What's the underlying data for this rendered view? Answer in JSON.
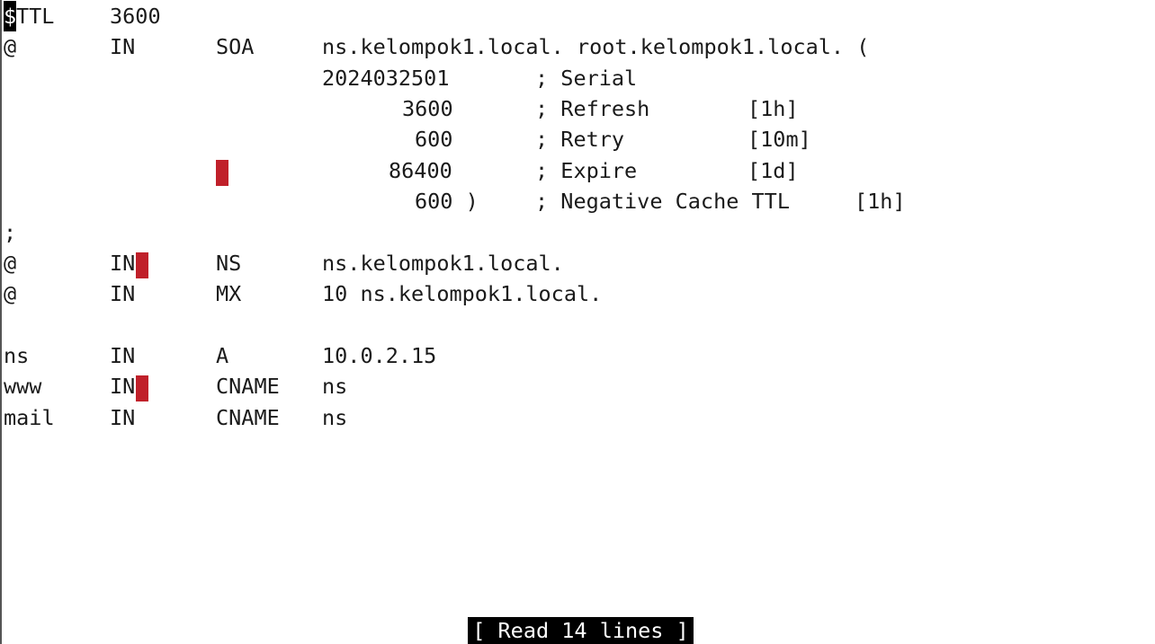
{
  "editor": {
    "ttl_line": {
      "cursor_char": "$",
      "directive": "TTL",
      "value": "3600"
    },
    "soa_line": {
      "name": "@",
      "class": "IN",
      "type": "SOA",
      "data": "ns.kelompok1.local. root.kelompok1.local. ("
    },
    "serial_line": {
      "value": "2024032501",
      "comment": "; Serial"
    },
    "refresh_line": {
      "value": "3600",
      "comment": "; Refresh",
      "unit": "[1h]"
    },
    "retry_line": {
      "value": "600",
      "comment": "; Retry",
      "unit": "[10m]"
    },
    "expire_line": {
      "value": "86400",
      "comment": "; Expire",
      "unit": "[1d]"
    },
    "negative_line": {
      "value": "600 )",
      "comment": "; Negative Cache TTL",
      "unit": "[1h]"
    },
    "separator_line": {
      "text": ";"
    },
    "records": [
      {
        "name": "@",
        "class": "IN",
        "type": "NS",
        "data": "ns.kelompok1.local."
      },
      {
        "name": "@",
        "class": "IN",
        "type": "MX",
        "data": "10 ns.kelompok1.local."
      },
      {
        "name": "ns",
        "class": "IN",
        "type": "A",
        "data": "10.0.2.15"
      },
      {
        "name": "www",
        "class": "IN",
        "type": "CNAME",
        "data": "ns"
      },
      {
        "name": "mail",
        "class": "IN",
        "type": "CNAME",
        "data": "ns"
      }
    ]
  },
  "status": {
    "message": "[ Read 14 lines ]"
  },
  "colors": {
    "background": "#ffffff",
    "text": "#1a1a1a",
    "trailing_whitespace_marker": "#c0202a",
    "status_bar_bg": "#000000",
    "status_bar_text": "#ffffff"
  }
}
